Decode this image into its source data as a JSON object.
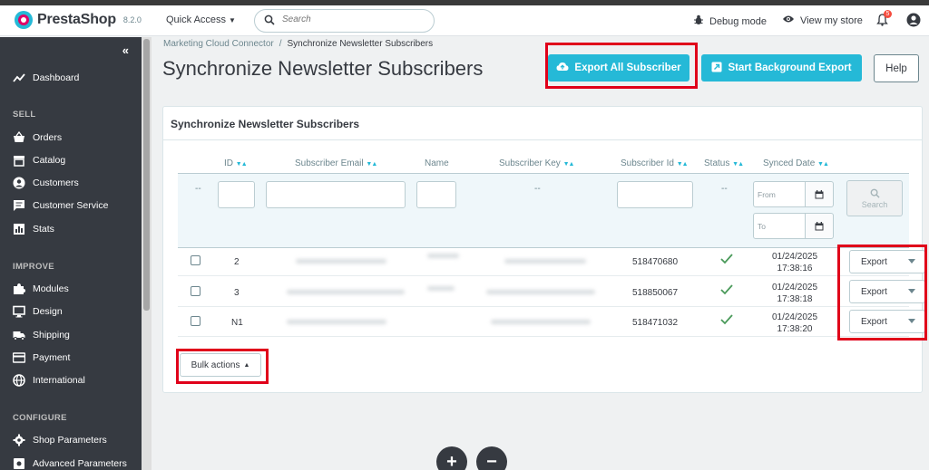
{
  "header": {
    "logo_text": "PrestaShop",
    "version": "8.2.0",
    "quick_access": "Quick Access",
    "search_placeholder": "Search",
    "debug_mode": "Debug mode",
    "view_store": "View my store",
    "notifications_count": "5"
  },
  "sidebar": {
    "dashboard": "Dashboard",
    "sections": {
      "sell": "SELL",
      "improve": "IMPROVE",
      "configure": "CONFIGURE"
    },
    "sell_items": [
      "Orders",
      "Catalog",
      "Customers",
      "Customer Service",
      "Stats"
    ],
    "improve_items": [
      "Modules",
      "Design",
      "Shipping",
      "Payment",
      "International"
    ],
    "configure_items": [
      "Shop Parameters",
      "Advanced Parameters"
    ]
  },
  "breadcrumb": {
    "parent": "Marketing Cloud Connector",
    "separator": "/",
    "current": "Synchronize Newsletter Subscribers"
  },
  "page": {
    "title": "Synchronize Newsletter Subscribers",
    "export_all_label": "Export All Subscriber",
    "background_export_label": "Start Background Export",
    "help_label": "Help"
  },
  "card": {
    "title": "Synchronize Newsletter Subscribers",
    "columns": [
      "ID",
      "Subscriber Email",
      "Name",
      "Subscriber Key",
      "Subscriber Id",
      "Status",
      "Synced Date"
    ],
    "filter_dash": "--",
    "date_from": "From",
    "date_to": "To",
    "search_label": "Search",
    "rows": [
      {
        "id": "2",
        "subscriber_id": "518470680",
        "date": "01/24/2025",
        "time": "17:38:16",
        "status": "synced"
      },
      {
        "id": "3",
        "subscriber_id": "518850067",
        "date": "01/24/2025",
        "time": "17:38:18",
        "status": "synced"
      },
      {
        "id": "N1",
        "subscriber_id": "518471032",
        "date": "01/24/2025",
        "time": "17:38:20",
        "status": "synced"
      }
    ],
    "export_label": "Export",
    "bulk_actions": "Bulk actions"
  },
  "colors": {
    "accent": "#25b9d7",
    "sidebar_bg": "#363a41",
    "highlight_box": "#e0001a",
    "success": "#70b580"
  },
  "icons": {
    "debug": "bug-icon",
    "view_store": "eye-icon",
    "notifications": "bell-icon",
    "user": "user-circle-icon",
    "export_all": "cloud-upload-icon",
    "background_export": "external-link-icon"
  }
}
